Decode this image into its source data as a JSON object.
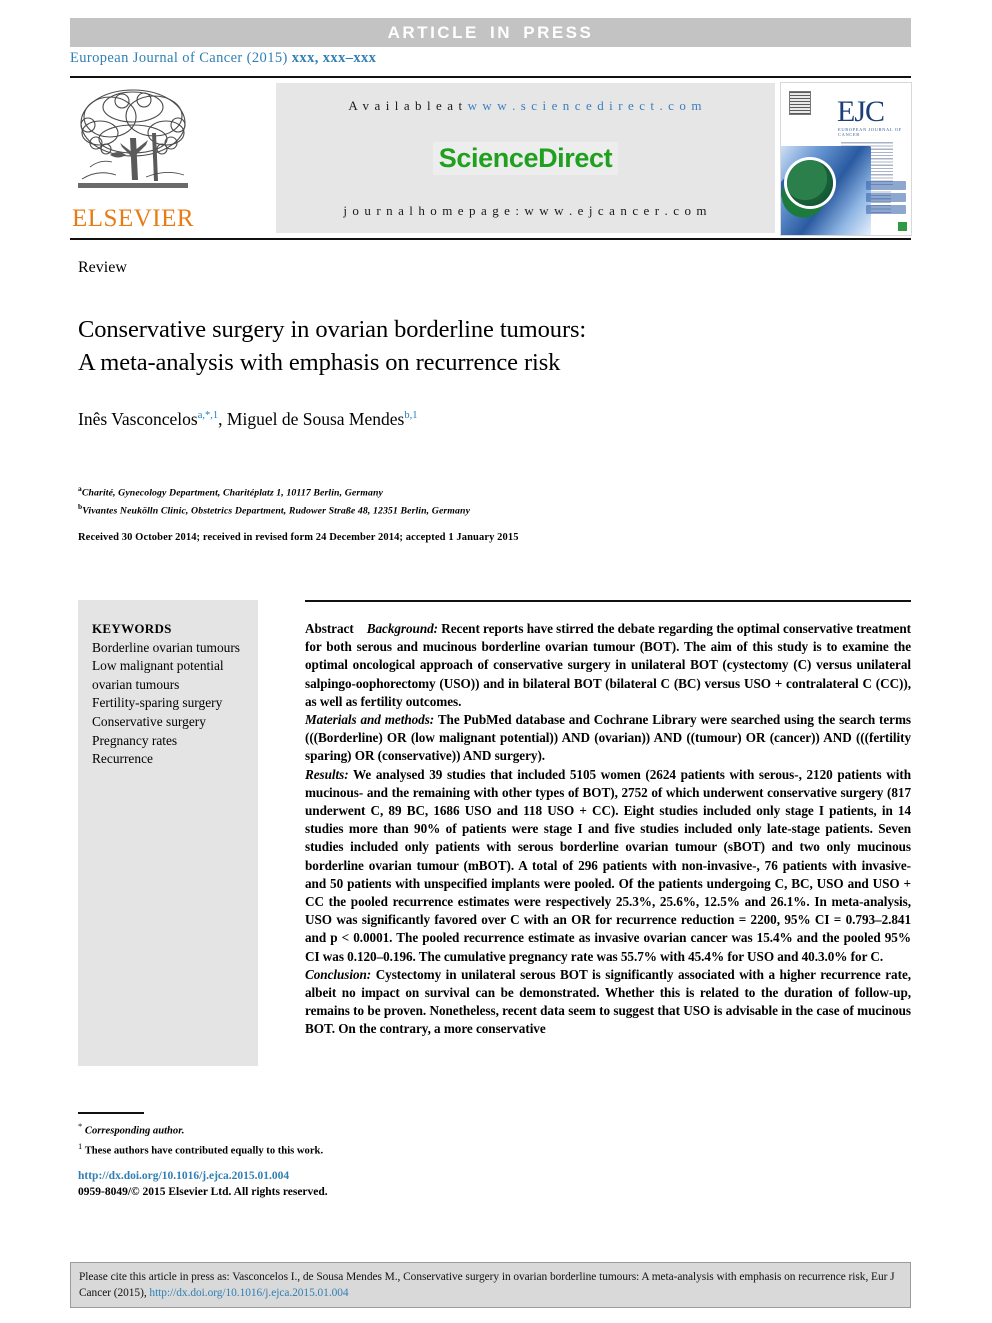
{
  "banner": {
    "label": "ARTICLE IN PRESS"
  },
  "journal_line": {
    "name": "European Journal of Cancer (2015)",
    "volume_pages": "xxx, xxx–xxx"
  },
  "header": {
    "publisher_logo_name": "ELSEVIER",
    "available_prefix": "A v a i l a b l e   a t",
    "available_url": "w w w . s c i e n c e d i r e c t . c o m",
    "sciencedirect_logo": "ScienceDirect",
    "homepage": "j o u r n a l   h o m e p a g e :   w w w . e j c a n c e r . c o m",
    "cover": {
      "acronym": "EJC",
      "subtitle": "EUROPEAN JOURNAL OF CANCER"
    }
  },
  "article": {
    "type_label": "Review",
    "title_line1": "Conservative surgery in ovarian borderline tumours:",
    "title_line2": "A meta-analysis with emphasis on recurrence risk",
    "authors": [
      {
        "name": "Inês Vasconcelos",
        "marks": "a,*,1"
      },
      {
        "name": "Miguel de Sousa Mendes",
        "marks": "b,1"
      }
    ],
    "author_separator": ", ",
    "affiliations": [
      {
        "mark": "a",
        "text": "Charité, Gynecology Department, Charitéplatz 1, 10117 Berlin, Germany"
      },
      {
        "mark": "b",
        "text": "Vivantes Neukölln Clinic, Obstetrics Department, Rudower Straße 48, 12351 Berlin, Germany"
      }
    ],
    "history": "Received 30 October 2014; received in revised form 24 December 2014; accepted 1 January 2015"
  },
  "keywords": {
    "heading": "KEYWORDS",
    "items": [
      "Borderline ovarian tumours",
      "Low malignant potential ovarian tumours",
      "Fertility-sparing surgery",
      "Conservative surgery",
      "Pregnancy rates",
      "Recurrence"
    ]
  },
  "abstract": {
    "label": "Abstract",
    "sections": [
      {
        "heading": "Background:",
        "body": "Recent reports have stirred the debate regarding the optimal conservative treatment for both serous and mucinous borderline ovarian tumour (BOT). The aim of this study is to examine the optimal oncological approach of conservative surgery in unilateral BOT (cystectomy (C) versus unilateral salpingo-oophorectomy (USO)) and in bilateral BOT (bilateral C (BC) versus USO + contralateral C (CC)), as well as fertility outcomes."
      },
      {
        "heading": "Materials and methods:",
        "body": "The PubMed database and Cochrane Library were searched using the search terms (((Borderline) OR (low malignant potential)) AND (ovarian)) AND ((tumour) OR (cancer)) AND (((fertility sparing) OR (conservative)) AND surgery)."
      },
      {
        "heading": "Results:",
        "body": "We analysed 39 studies that included 5105 women (2624 patients with serous-, 2120 patients with mucinous- and the remaining with other types of BOT), 2752 of which underwent conservative surgery (817 underwent C, 89 BC, 1686 USO and 118 USO + CC). Eight studies included only stage I patients, in 14 studies more than 90% of patients were stage I and five studies included only late-stage patients. Seven studies included only patients with serous borderline ovarian tumour (sBOT) and two only mucinous borderline ovarian tumour (mBOT). A total of 296 patients with non-invasive-, 76 patients with invasive- and 50 patients with unspecified implants were pooled. Of the patients undergoing C, BC, USO and USO + CC the pooled recurrence estimates were respectively 25.3%, 25.6%, 12.5% and 26.1%. In meta-analysis, USO was significantly favored over C with an OR for recurrence reduction = 2200, 95% CI = 0.793–2.841 and p < 0.0001. The pooled recurrence estimate as invasive ovarian cancer was 15.4% and the pooled 95% CI was 0.120–0.196. The cumulative pregnancy rate was 55.7% with 45.4% for USO and 40.3.0% for C."
      },
      {
        "heading": "Conclusion:",
        "body": "Cystectomy in unilateral serous BOT is significantly associated with a higher recurrence rate, albeit no impact on survival can be demonstrated. Whether this is related to the duration of follow-up, remains to be proven. Nonetheless, recent data seem to suggest that USO is advisable in the case of mucinous BOT. On the contrary, a more conservative"
      }
    ]
  },
  "footnotes": {
    "corresponding_mark": "*",
    "corresponding_text": "Corresponding author.",
    "equal_mark": "1",
    "equal_text": "These authors have contributed equally to this work."
  },
  "imprint": {
    "doi": "http://dx.doi.org/10.1016/j.ejca.2015.01.004",
    "copyright": "0959-8049/© 2015 Elsevier Ltd. All rights reserved."
  },
  "citation_footer": {
    "text_before_link": "Please cite this article in press as: Vasconcelos I., de Sousa Mendes M., Conservative surgery in ovarian borderline tumours: A meta-analysis with emphasis on recurrence risk, Eur J Cancer (2015), ",
    "link": "http://dx.doi.org/10.1016/j.ejca.2015.01.004"
  },
  "colors": {
    "banner_bg": "#c3c3c3",
    "journal_blue": "#2f7fb4",
    "elsevier_orange": "#e87b15",
    "sciencedirect_green": "#1fa01f",
    "sidebar_gray": "#e4e4e4",
    "footer_gray": "#d9d9d9"
  }
}
